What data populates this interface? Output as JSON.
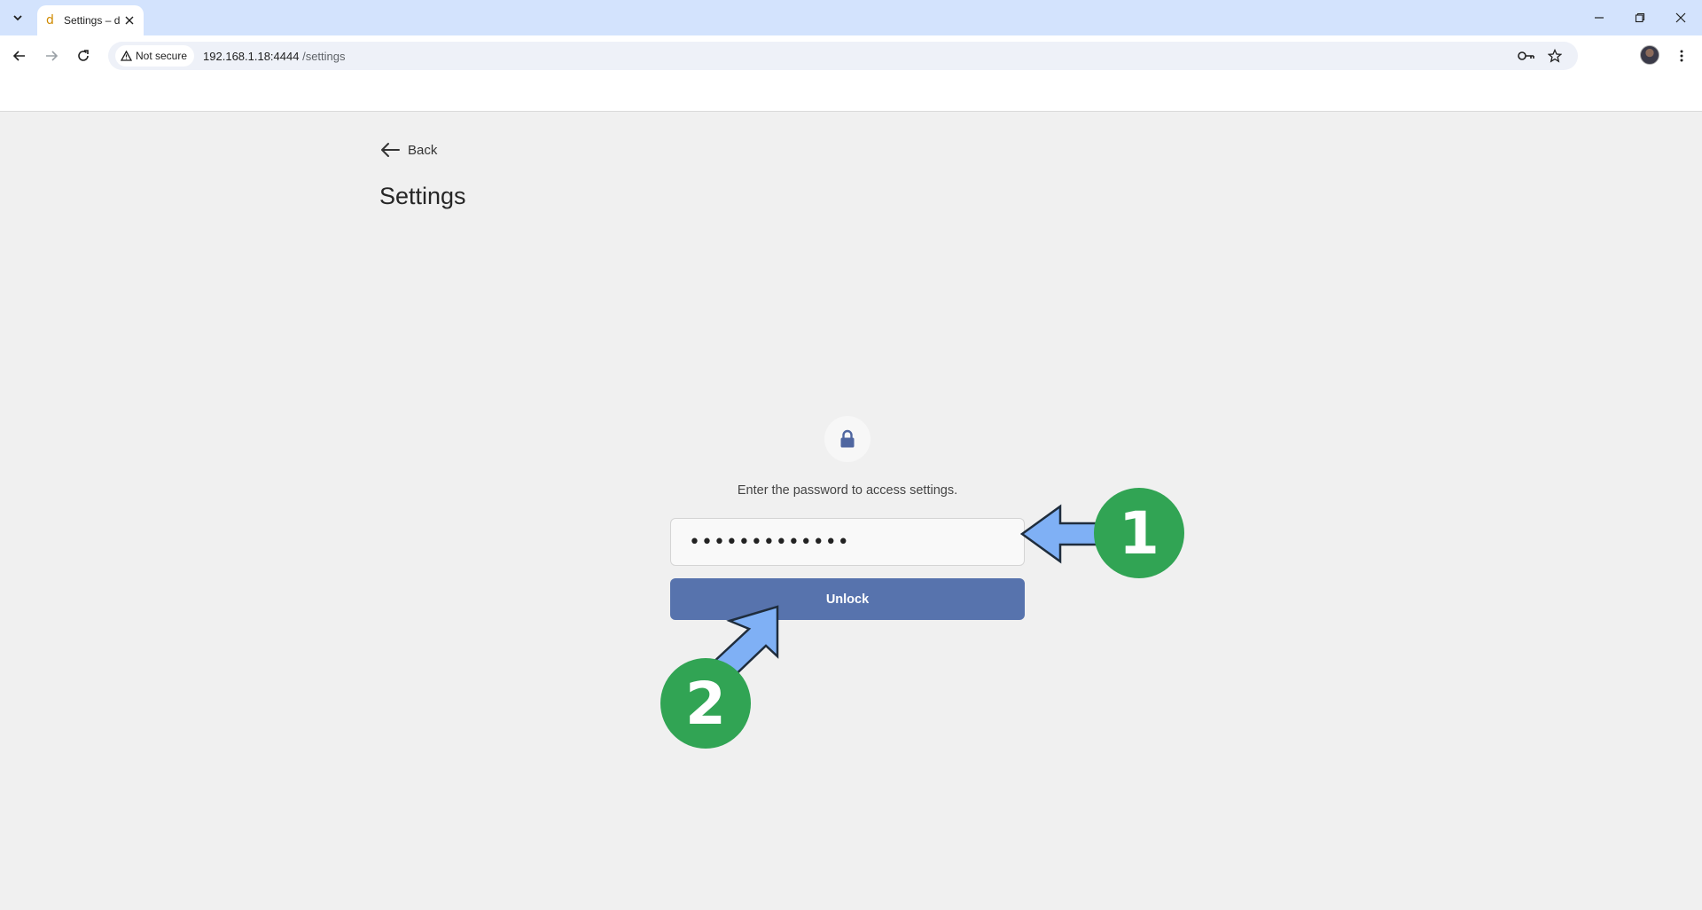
{
  "browser": {
    "tab_title": "Settings – d",
    "favicon_glyph": "d",
    "security_label": "Not secure",
    "url_host": "192.168.1.18:4444",
    "url_path": " /settings"
  },
  "page": {
    "back_label": "Back",
    "title": "Settings"
  },
  "lock_panel": {
    "prompt": "Enter the password to access settings.",
    "password_value": "•••••••••••••",
    "unlock_label": "Unlock"
  },
  "annotations": {
    "step1": "1",
    "step2": "2",
    "badge_color": "#31a454",
    "arrow_color": "#7fb0f5"
  },
  "colors": {
    "tabstrip": "#d3e3fd",
    "page_bg": "#f0f0f0",
    "button": "#5773ad"
  }
}
